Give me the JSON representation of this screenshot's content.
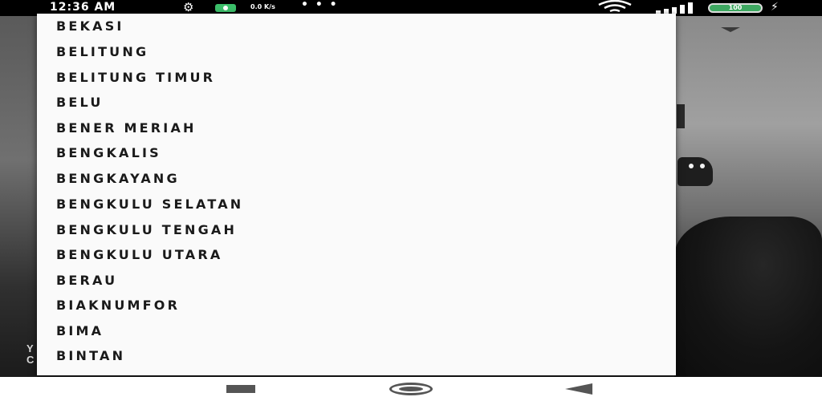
{
  "status_bar": {
    "time": "12:36 AM",
    "net_speed": "0.0 K/s",
    "more_dots": "• • •",
    "battery": "100"
  },
  "dropdown": {
    "options": [
      "BEKASI",
      "BELITUNG",
      "BELITUNG TIMUR",
      "BELU",
      "BENER MERIAH",
      "BENGKALIS",
      "BENGKAYANG",
      "BENGKULU SELATAN",
      "BENGKULU TENGAH",
      "BENGKULU UTARA",
      "BERAU",
      "BIAKNUMFOR",
      "BIMA",
      "BINTAN"
    ]
  },
  "background": {
    "left_text_1": "Y",
    "left_text_2": "C"
  },
  "icons": {
    "status": [
      "settings-icon",
      "app-notification-icon",
      "wifi-icon",
      "signal-icon",
      "battery-icon",
      "charging-icon"
    ],
    "nav": [
      "recent-apps-icon",
      "home-icon",
      "back-icon"
    ],
    "spinner": "chevron-down-icon"
  }
}
